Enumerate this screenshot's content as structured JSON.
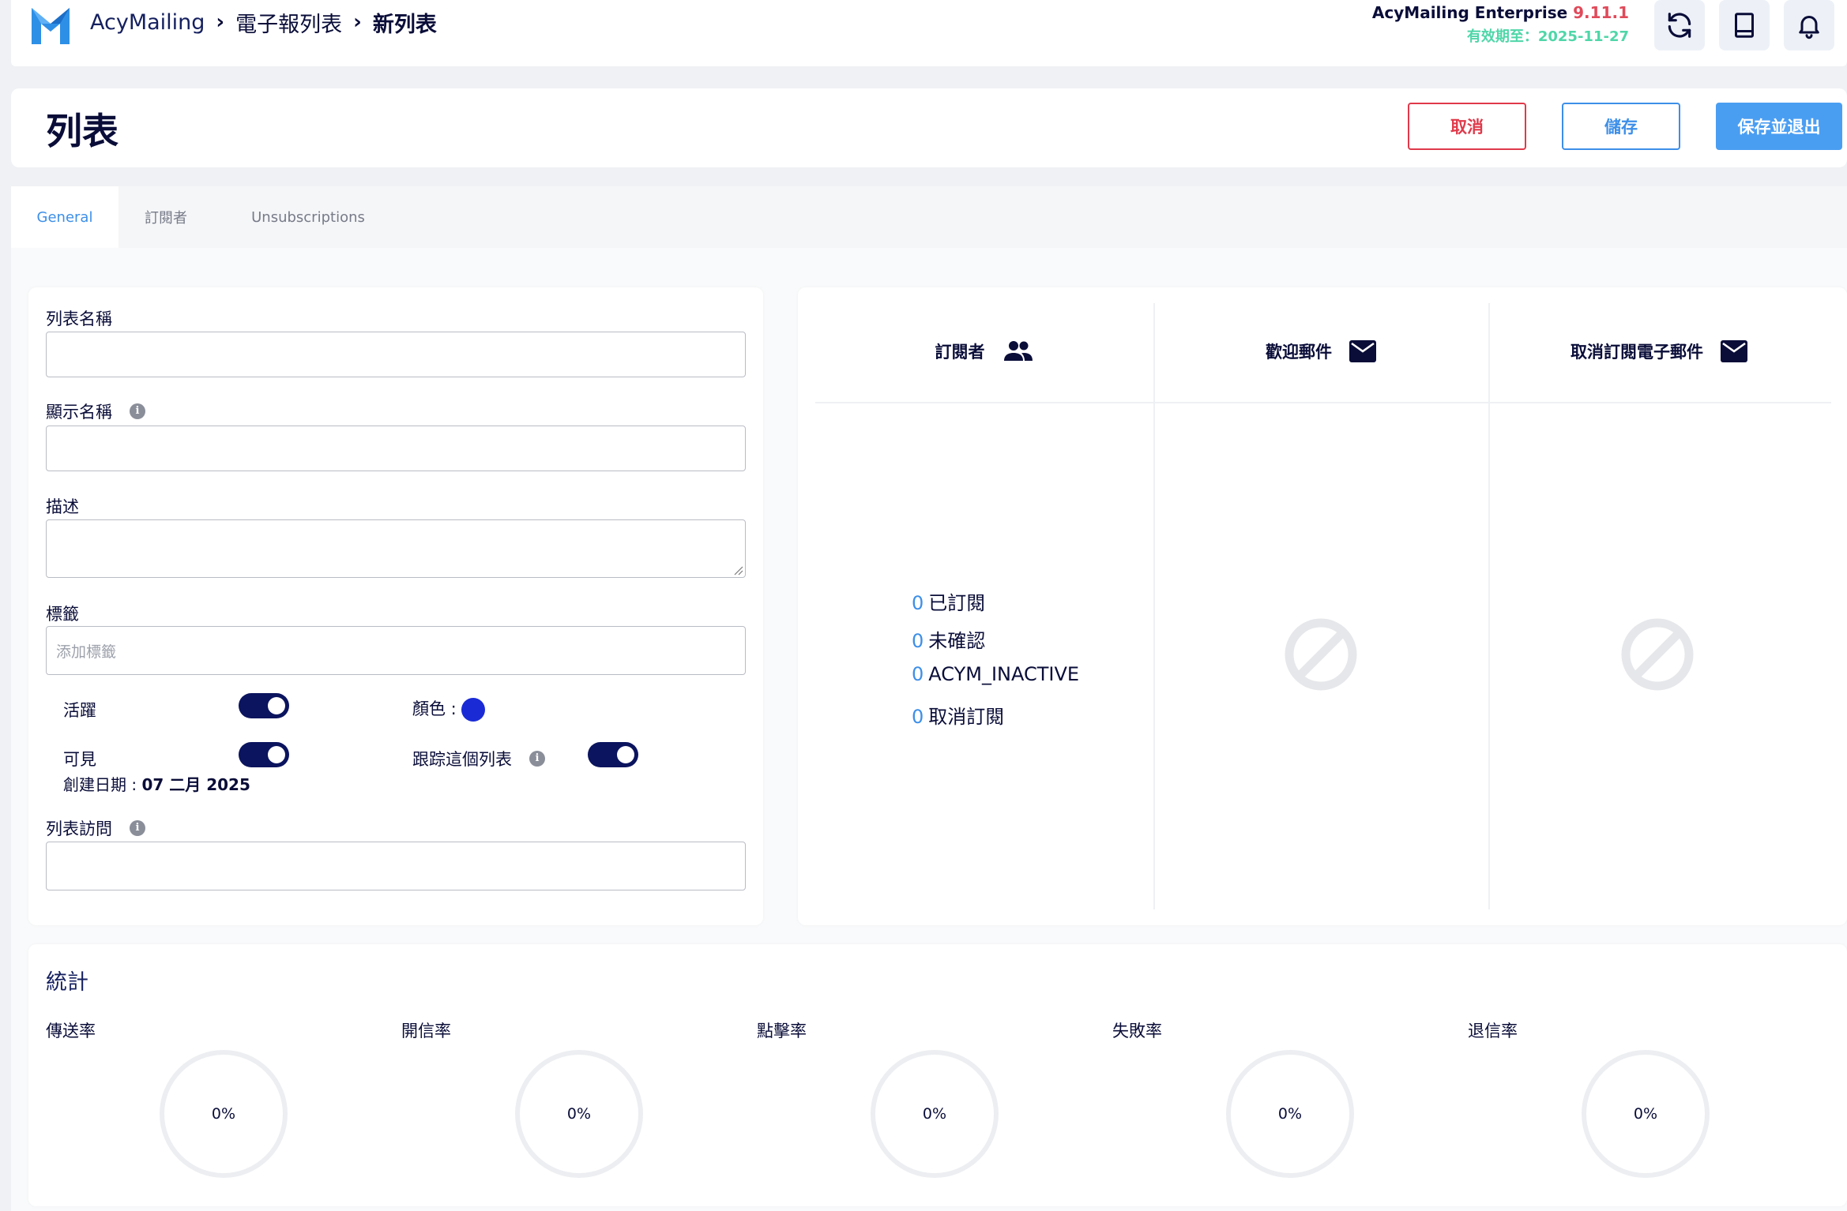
{
  "header": {
    "breadcrumb": [
      "AcyMailing",
      "電子報列表",
      "新列表"
    ],
    "edition_name": "AcyMailing Enterprise",
    "version": "9.11.1",
    "expiry": "有效期至：2025-11-27",
    "icons": [
      "refresh-icon",
      "book-icon",
      "bell-icon"
    ]
  },
  "page": {
    "title": "列表",
    "cancel_label": "取消",
    "save_label": "儲存",
    "save_exit_label": "保存並退出"
  },
  "tabs": [
    {
      "label": "General",
      "active": true
    },
    {
      "label": "訂閱者",
      "active": false
    },
    {
      "label": "Unsubscriptions",
      "active": false
    }
  ],
  "form": {
    "list_name_label": "列表名稱",
    "list_name_value": "",
    "display_name_label": "顯示名稱",
    "display_name_value": "",
    "description_label": "描述",
    "description_value": "",
    "tags_label": "標籤",
    "tags_placeholder": "添加標籤",
    "active_label": "活躍",
    "active_on": true,
    "visible_label": "可見",
    "visible_on": true,
    "color_label": "顏色 :",
    "color_value": "#1a2bd6",
    "track_label": "跟踪這個列表",
    "track_on": true,
    "created_label": "創建日期 :",
    "created_value": "07 二月 2025",
    "access_label": "列表訪問",
    "access_value": ""
  },
  "summary": {
    "subscribers_title": "訂閱者",
    "welcome_title": "歡迎郵件",
    "unsub_title": "取消訂閱電子郵件",
    "counts": [
      {
        "value": "0",
        "label": "已訂閱"
      },
      {
        "value": "0",
        "label": "未確認"
      },
      {
        "value": "0",
        "label": "ACYM_INACTIVE"
      },
      {
        "value": "0",
        "label": "取消訂閱"
      }
    ]
  },
  "stats": {
    "title": "統計",
    "metrics": [
      {
        "label": "傳送率",
        "value": "0%"
      },
      {
        "label": "開信率",
        "value": "0%"
      },
      {
        "label": "點擊率",
        "value": "0%"
      },
      {
        "label": "失敗率",
        "value": "0%"
      },
      {
        "label": "退信率",
        "value": "0%"
      }
    ]
  },
  "colors": {
    "primary_dark": "#0b145e",
    "accent_blue": "#3d8fe8",
    "danger_red": "#e0394a",
    "expiry_green": "#4fd6a8"
  }
}
